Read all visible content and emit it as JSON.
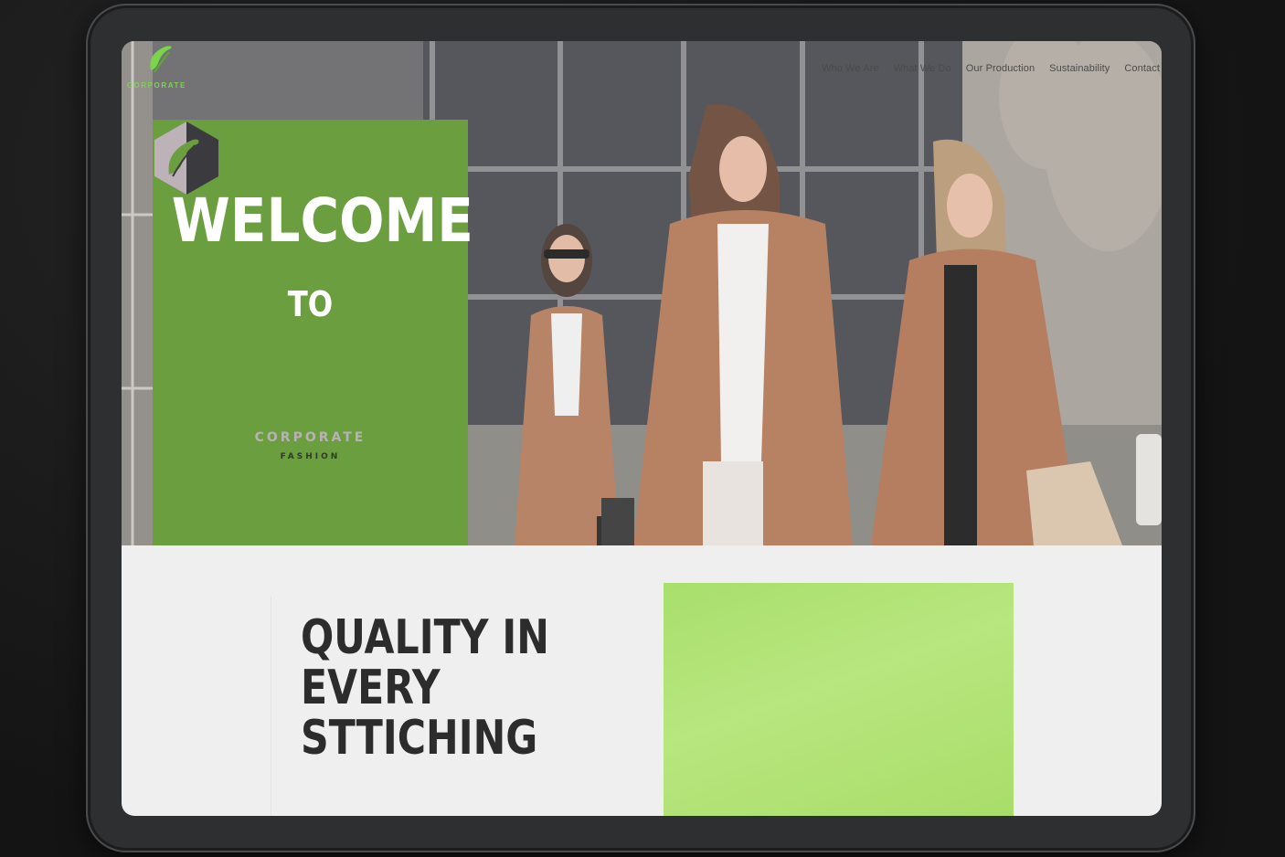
{
  "site": {
    "logo_small_text": "CORPORATE",
    "nav": [
      {
        "label": "Who We Are"
      },
      {
        "label": "What We Do"
      },
      {
        "label": "Our Production"
      },
      {
        "label": "Sustainability"
      },
      {
        "label": "Contact"
      }
    ]
  },
  "hero": {
    "welcome_title": "WELCOME",
    "welcome_to": "TO",
    "brand_name": "CORPORATE",
    "brand_sub": "FASHION",
    "photo_icon": "women-in-coats-photo"
  },
  "section": {
    "heading": "QUALITY IN\nEVERY\nSTTICHING"
  },
  "colors": {
    "accent_green": "#6a9e3e",
    "light_green": "#a8df6c",
    "logo_green": "#7bd44a",
    "page_bg": "#efefef",
    "text_dark": "#2c2c2c"
  }
}
